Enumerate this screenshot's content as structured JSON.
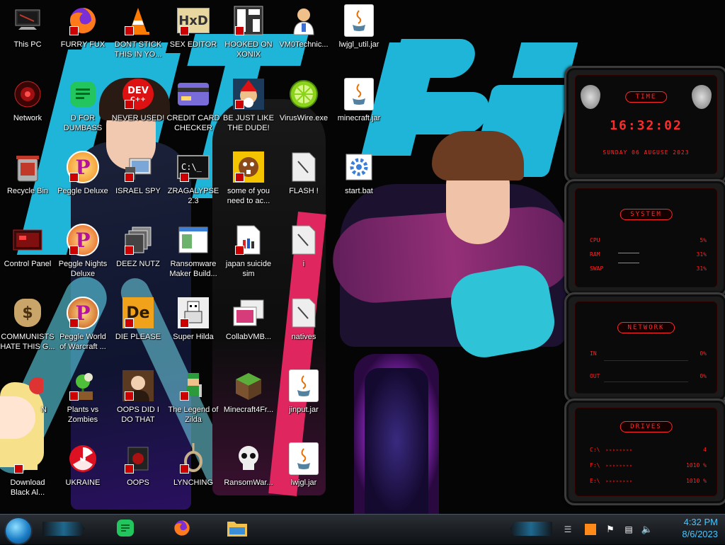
{
  "desktop": {
    "icons": [
      {
        "label": "This PC"
      },
      {
        "label": "FURRY FUX"
      },
      {
        "label": "DONT STICK THIS IN YO..."
      },
      {
        "label": "SEX EDITOR"
      },
      {
        "label": "HOOKED ON XONIX"
      },
      {
        "label": "VM0Technic..."
      },
      {
        "label": "lwjgl_util.jar"
      },
      {
        "label": "Network"
      },
      {
        "label": "D FOR DUMBASS"
      },
      {
        "label": "NEVER USED!"
      },
      {
        "label": "CREDIT CARD CHECKER"
      },
      {
        "label": "BE JUST LIKE THE DUDE!"
      },
      {
        "label": "VirusWire.exe"
      },
      {
        "label": "minecraft.jar"
      },
      {
        "label": "Recycle Bin"
      },
      {
        "label": "Peggle Deluxe"
      },
      {
        "label": "ISRAEL SPY"
      },
      {
        "label": "ZRAGALYPSE 2.3"
      },
      {
        "label": "some of you need to ac..."
      },
      {
        "label": "FLASH !"
      },
      {
        "label": "start.bat"
      },
      {
        "label": "Control Panel"
      },
      {
        "label": "Peggle Nights Deluxe"
      },
      {
        "label": "DEEZ NUTZ"
      },
      {
        "label": "Ransomware Maker Build..."
      },
      {
        "label": "japan suicide sim"
      },
      {
        "label": "i"
      },
      {
        "label": "COMMUNISTS HATE THIS G..."
      },
      {
        "label": "Peggle World of Warcraft ..."
      },
      {
        "label": "DIE PLEASE"
      },
      {
        "label": "Super Hilda"
      },
      {
        "label": "CollabVMB..."
      },
      {
        "label": "natives"
      },
      {
        "label": "N"
      },
      {
        "label": "Plants vs Zombies"
      },
      {
        "label": "OOPS DID I DO THAT"
      },
      {
        "label": "The Legend of Zilda"
      },
      {
        "label": "Minecraft4Fr..."
      },
      {
        "label": "jinput.jar"
      },
      {
        "label": "Download Black Al..."
      },
      {
        "label": "UKRAINE"
      },
      {
        "label": "OOPS"
      },
      {
        "label": "LYNCHING"
      },
      {
        "label": "RansomWar..."
      },
      {
        "label": "lwjgl.jar"
      }
    ],
    "tiles": {
      "java": "jar",
      "dev": "DEV",
      "devsub": "C++",
      "hxd": "HxD",
      "de": "De",
      "p": "P",
      "dollar": "$",
      "console": "C:\\_"
    }
  },
  "gadgets": {
    "time": {
      "title": "TIME",
      "clock": "16:32:02",
      "date": "SUNDAY 06 AUGUSE 2023"
    },
    "system": {
      "title": "SYSTEM",
      "rows": [
        {
          "k": "CPU",
          "v": "5%"
        },
        {
          "k": "RAM",
          "v": "31%"
        },
        {
          "k": "SWAP",
          "v": "31%"
        }
      ]
    },
    "network": {
      "title": "NETWORK",
      "rows": [
        {
          "k": "IN",
          "v": "0%"
        },
        {
          "k": "OUT",
          "v": "0%"
        }
      ]
    },
    "drives": {
      "title": "DRIVES",
      "rows": [
        {
          "k": "C:\\",
          "v": "4"
        },
        {
          "k": "F:\\",
          "v": "1010 %"
        },
        {
          "k": "E:\\",
          "v": "1010 %"
        }
      ]
    }
  },
  "taskbar": {
    "clock_time": "4:32 PM",
    "clock_date": "8/6/2023"
  }
}
